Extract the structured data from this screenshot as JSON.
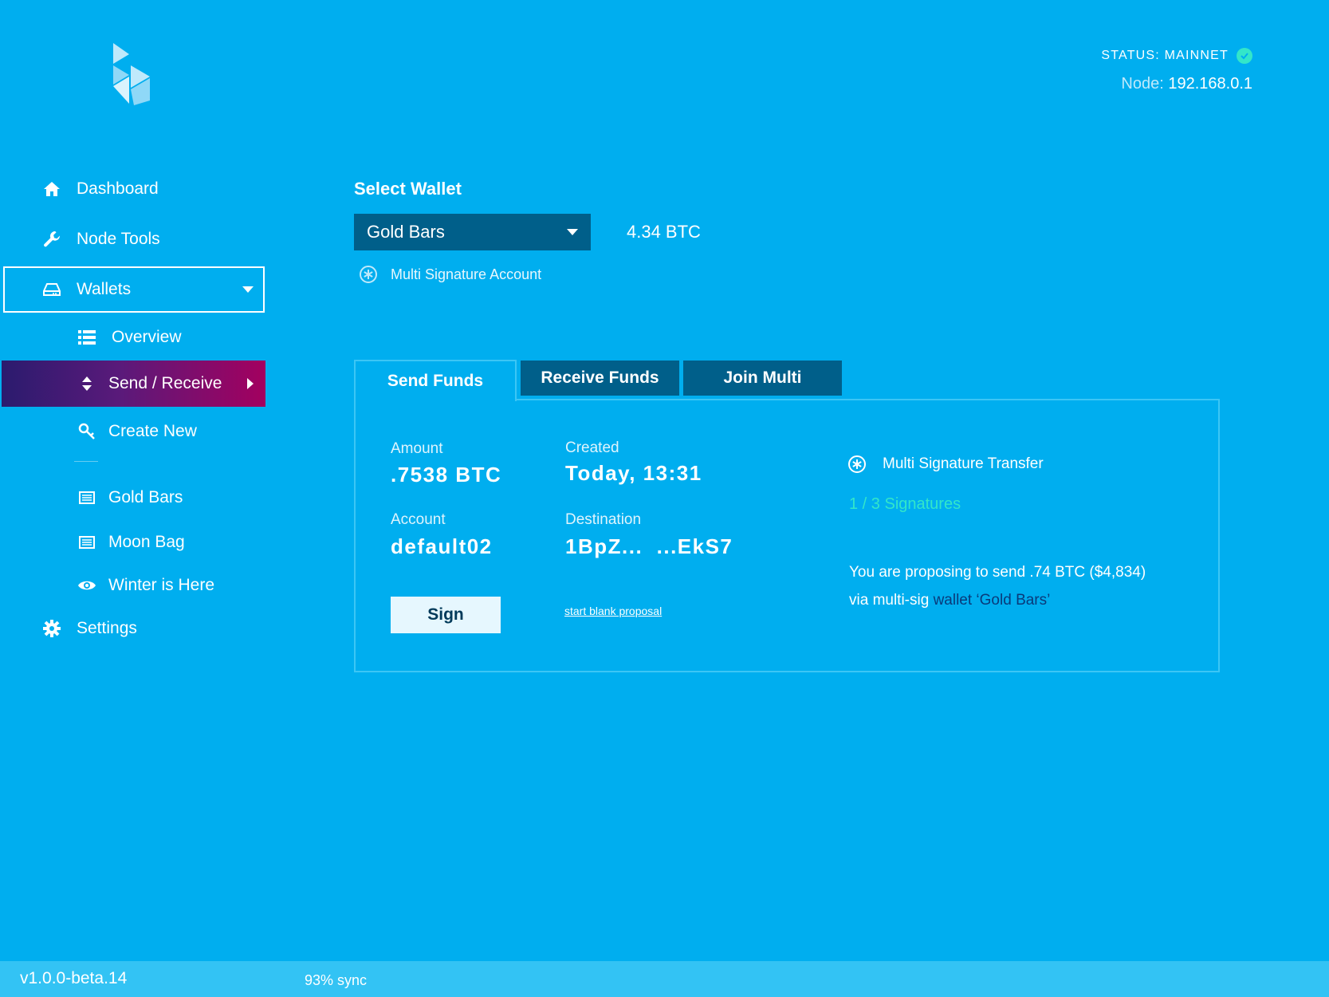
{
  "header": {
    "status_text": "STATUS: MAINNET",
    "node_label": "Node:",
    "node_value": "192.168.0.1"
  },
  "sidebar": {
    "dashboard": "Dashboard",
    "node_tools": "Node Tools",
    "wallets": "Wallets",
    "overview": "Overview",
    "send_receive": "Send / Receive",
    "create_new": "Create New",
    "wallet_list": [
      "Gold Bars",
      "Moon Bag",
      "Winter is Here"
    ],
    "settings": "Settings"
  },
  "main": {
    "select_wallet_heading": "Select Wallet",
    "selected_wallet": "Gold Bars",
    "balance": "4.34 BTC",
    "account_type": "Multi Signature Account",
    "tabs": [
      "Send Funds",
      "Receive Funds",
      "Join Multi"
    ],
    "amount_label": "Amount",
    "amount_value": ".7538 BTC",
    "created_label": "Created",
    "created_value": "Today, 13:31",
    "account_label": "Account",
    "account_value": "default02",
    "destination_label": "Destination",
    "destination_value": "1BpZ...  ...EkS7",
    "sign_button": "Sign",
    "blank_proposal_link": "start blank proposal",
    "transfer_type": "Multi Signature Transfer",
    "signatures": "1 / 3 Signatures",
    "proposal_line1": "You are proposing to send .74 BTC ($4,834)",
    "proposal_line2_prefix": "via multi-sig ",
    "proposal_wallet_link": "wallet ‘Gold Bars’"
  },
  "footer": {
    "version": "v1.0.0-beta.14",
    "sync": "93% sync"
  },
  "colors": {
    "background": "#00aeef",
    "dark_panel": "#005f8a",
    "accent_teal": "#33e6c9",
    "active_gradient_start": "#2b1b6e",
    "active_gradient_end": "#a3005f"
  }
}
